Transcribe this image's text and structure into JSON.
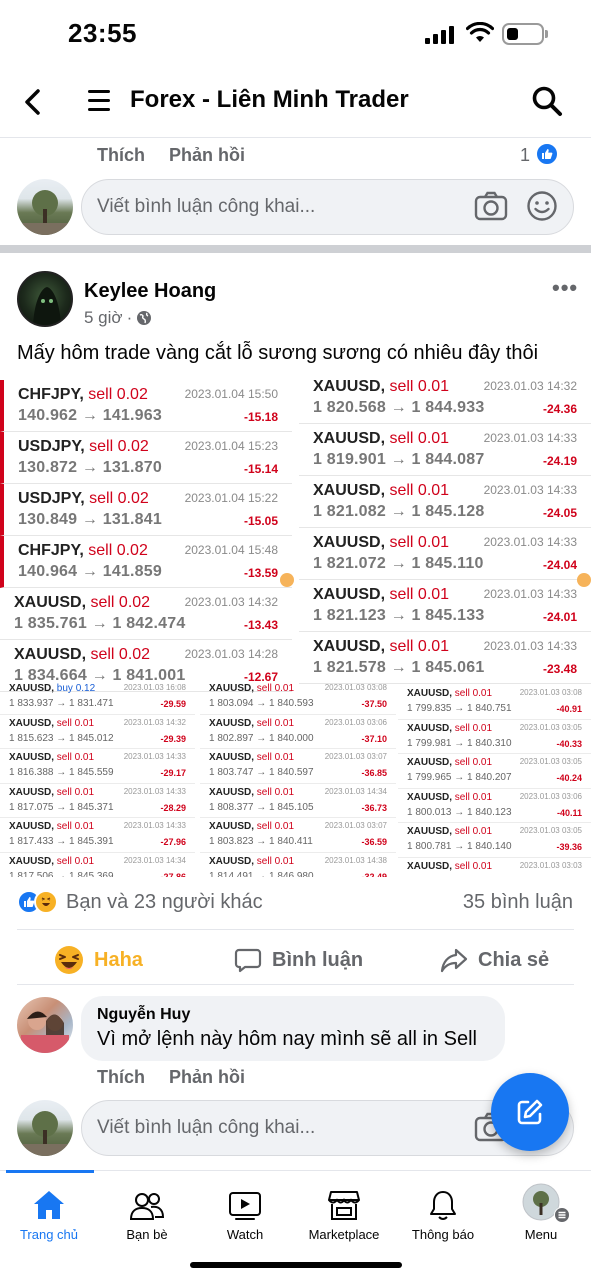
{
  "status": {
    "time": "23:55"
  },
  "header": {
    "title": "Forex - Liên Minh Trader"
  },
  "prev_post": {
    "like_label": "Thích",
    "reply_label": "Phản hồi",
    "like_count": "1"
  },
  "comment_input": {
    "placeholder": "Viết bình luận công khai..."
  },
  "post": {
    "author": "Keylee Hoang",
    "time": "5 giờ",
    "separator": "·",
    "text": "Mấy hôm trade vàng cắt lỗ sương sương có nhiêu đây thôi",
    "reactions_text": "Bạn và 23 người khác",
    "comments_count": "35 bình luận",
    "actions": {
      "haha": "Haha",
      "comment": "Bình luận",
      "share": "Chia sẻ"
    }
  },
  "trades_left": [
    {
      "pair": "CHFJPY,",
      "action": "sell 0.02",
      "prices": "140.962 → 141.963",
      "time": "2023.01.04 15:50",
      "profit": "-15.18"
    },
    {
      "pair": "USDJPY,",
      "action": "sell 0.02",
      "prices": "130.872 → 131.870",
      "time": "2023.01.04 15:23",
      "profit": "-15.14"
    },
    {
      "pair": "USDJPY,",
      "action": "sell 0.02",
      "prices": "130.849 → 131.841",
      "time": "2023.01.04 15:22",
      "profit": "-15.05"
    },
    {
      "pair": "CHFJPY,",
      "action": "sell 0.02",
      "prices": "140.964 → 141.859",
      "time": "2023.01.04 15:48",
      "profit": "-13.59"
    },
    {
      "pair": "XAUUSD,",
      "action": "sell 0.02",
      "prices": "1 835.761 → 1 842.474",
      "time": "2023.01.03 14:32",
      "profit": "-13.43"
    },
    {
      "pair": "XAUUSD,",
      "action": "sell 0.02",
      "prices": "1 834.664 → 1 841.001",
      "time": "2023.01.03 14:28",
      "profit": "-12.67"
    }
  ],
  "trades_right": [
    {
      "pair": "XAUUSD,",
      "action": "sell 0.01",
      "prices": "1 820.568 → 1 844.933",
      "time": "2023.01.03 14:32",
      "profit": "-24.36"
    },
    {
      "pair": "XAUUSD,",
      "action": "sell 0.01",
      "prices": "1 819.901 → 1 844.087",
      "time": "2023.01.03 14:33",
      "profit": "-24.19"
    },
    {
      "pair": "XAUUSD,",
      "action": "sell 0.01",
      "prices": "1 821.082 → 1 845.128",
      "time": "2023.01.03 14:33",
      "profit": "-24.05"
    },
    {
      "pair": "XAUUSD,",
      "action": "sell 0.01",
      "prices": "1 821.072 → 1 845.110",
      "time": "2023.01.03 14:33",
      "profit": "-24.04"
    },
    {
      "pair": "XAUUSD,",
      "action": "sell 0.01",
      "prices": "1 821.123 → 1 845.133",
      "time": "2023.01.03 14:33",
      "profit": "-24.01"
    },
    {
      "pair": "XAUUSD,",
      "action": "sell 0.01",
      "prices": "1 821.578 → 1 845.061",
      "time": "2023.01.03 14:33",
      "profit": "-23.48"
    }
  ],
  "trades_small_col1": [
    {
      "pair": "XAUUSD,",
      "action": "buy 0.12",
      "buy": true,
      "prices": "1 833.937 → 1 831.471",
      "time": "2023.01.03 16:08",
      "profit": "-29.59"
    },
    {
      "pair": "XAUUSD,",
      "action": "sell 0.01",
      "prices": "1 815.623 → 1 845.012",
      "time": "2023.01.03 14:32",
      "profit": "-29.39"
    },
    {
      "pair": "XAUUSD,",
      "action": "sell 0.01",
      "prices": "1 816.388 → 1 845.559",
      "time": "2023.01.03 14:33",
      "profit": "-29.17"
    },
    {
      "pair": "XAUUSD,",
      "action": "sell 0.01",
      "prices": "1 817.075 → 1 845.371",
      "time": "2023.01.03 14:33",
      "profit": "-28.29"
    },
    {
      "pair": "XAUUSD,",
      "action": "sell 0.01",
      "prices": "1 817.433 → 1 845.391",
      "time": "2023.01.03 14:33",
      "profit": "-27.96"
    },
    {
      "pair": "XAUUSD,",
      "action": "sell 0.01",
      "prices": "1 817.506 → 1 845.369",
      "time": "2023.01.03 14:34",
      "profit": "-27.86"
    }
  ],
  "trades_small_col2": [
    {
      "pair": "XAUUSD,",
      "action": "sell 0.01",
      "prices": "1 803.094 → 1 840.593",
      "time": "2023.01.03 03:08",
      "profit": "-37.50"
    },
    {
      "pair": "XAUUSD,",
      "action": "sell 0.01",
      "prices": "1 802.897 → 1 840.000",
      "time": "2023.01.03 03:06",
      "profit": "-37.10"
    },
    {
      "pair": "XAUUSD,",
      "action": "sell 0.01",
      "prices": "1 803.747 → 1 840.597",
      "time": "2023.01.03 03:07",
      "profit": "-36.85"
    },
    {
      "pair": "XAUUSD,",
      "action": "sell 0.01",
      "prices": "1 808.377 → 1 845.105",
      "time": "2023.01.03 14:34",
      "profit": "-36.73"
    },
    {
      "pair": "XAUUSD,",
      "action": "sell 0.01",
      "prices": "1 803.823 → 1 840.411",
      "time": "2023.01.03 03:07",
      "profit": "-36.59"
    },
    {
      "pair": "XAUUSD,",
      "action": "sell 0.01",
      "prices": "1 814.491 → 1 846.980",
      "time": "2023.01.03 14:38",
      "profit": "-32.49"
    }
  ],
  "trades_small_col3": [
    {
      "pair": "XAUUSD,",
      "action": "sell 0.01",
      "prices": "1 799.835 → 1 840.751",
      "time": "2023.01.03 03:08",
      "profit": "-40.91"
    },
    {
      "pair": "XAUUSD,",
      "action": "sell 0.01",
      "prices": "1 799.981 → 1 840.310",
      "time": "2023.01.03 03:05",
      "profit": "-40.33"
    },
    {
      "pair": "XAUUSD,",
      "action": "sell 0.01",
      "prices": "1 799.965 → 1 840.207",
      "time": "2023.01.03 03:05",
      "profit": "-40.24"
    },
    {
      "pair": "XAUUSD,",
      "action": "sell 0.01",
      "prices": "1 800.013 → 1 840.123",
      "time": "2023.01.03 03:06",
      "profit": "-40.11"
    },
    {
      "pair": "XAUUSD,",
      "action": "sell 0.01",
      "prices": "1 800.781 → 1 840.140",
      "time": "2023.01.03 03:05",
      "profit": "-39.36"
    },
    {
      "pair": "XAUUSD,",
      "action": "sell 0.01",
      "prices": "",
      "time": "2023.01.03 03:03",
      "profit": ""
    }
  ],
  "reply": {
    "name": "Nguyễn Huy",
    "text": "Vì mở lệnh này hôm nay mình sẽ all in Sell",
    "like_label": "Thích",
    "reply_label": "Phản hồi"
  },
  "nav": {
    "home": "Trang chủ",
    "friends": "Bạn bè",
    "watch": "Watch",
    "marketplace": "Marketplace",
    "notifications": "Thông báo",
    "menu": "Menu"
  },
  "colors": {
    "accent": "#1877f2",
    "loss": "#d0021b",
    "haha": "#f7b125"
  }
}
